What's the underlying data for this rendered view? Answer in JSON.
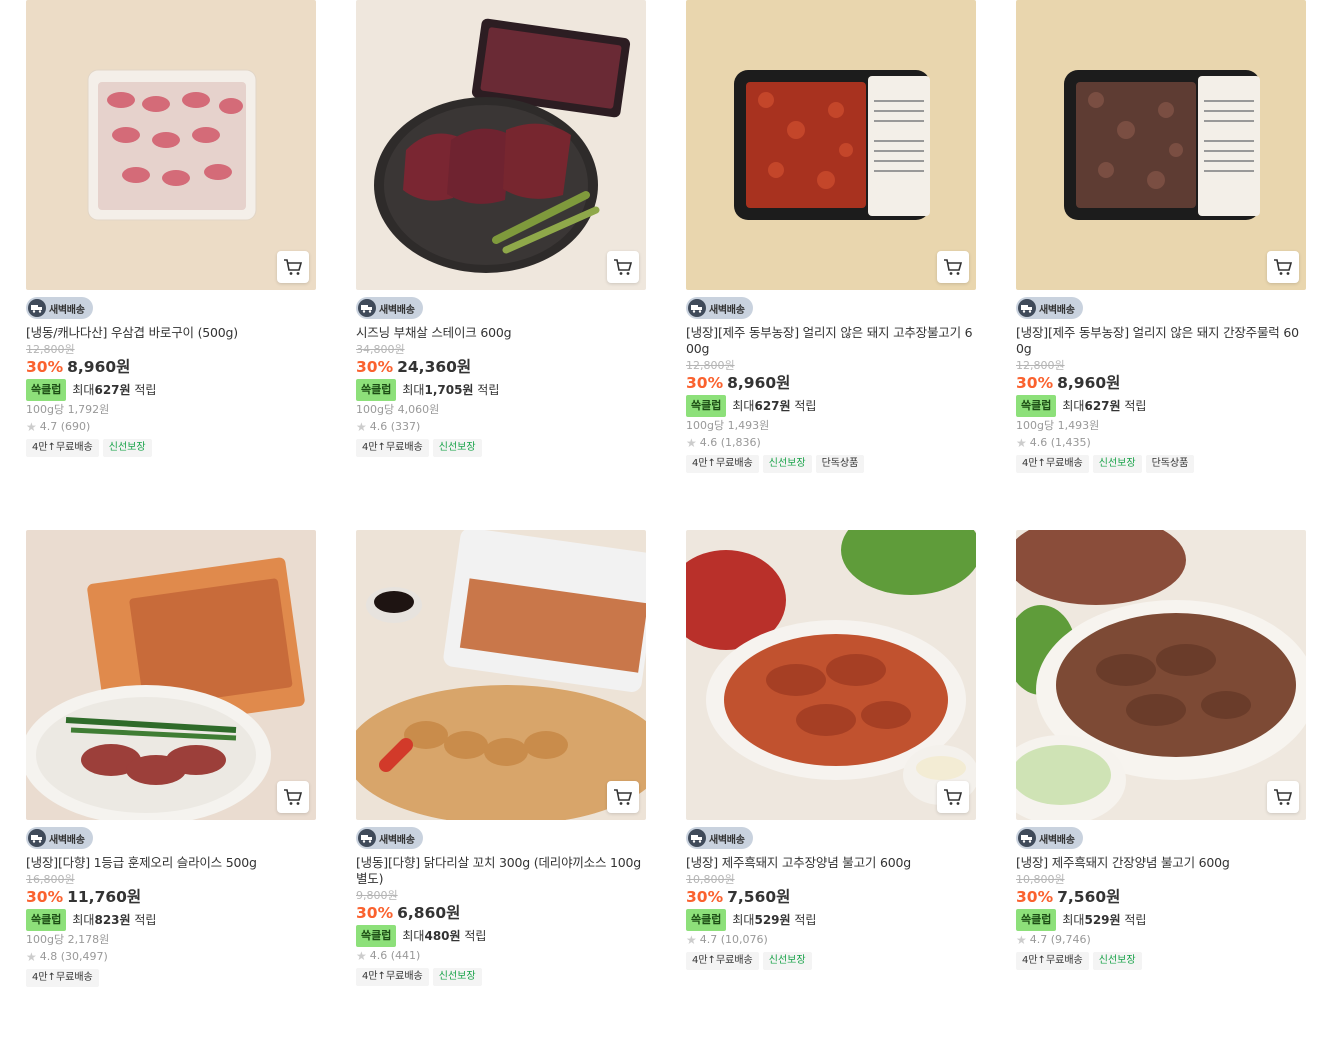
{
  "badge_label": "새벽배송",
  "point_label": "쓱클럽",
  "point_prefix": "최대",
  "point_suffix": "적립",
  "products": [
    {
      "name": "[냉동/캐나다산] 우삼겹 바로구이 (500g)",
      "orig": "12,800원",
      "disc": "30%",
      "price": "8,960원",
      "point": "627원",
      "per100": "100g당 1,792원",
      "rating": "4.7 (690)",
      "tags": [
        "4만↑무료배송",
        "신선보장"
      ]
    },
    {
      "name": "시즈닝 부채살 스테이크 600g",
      "orig": "34,800원",
      "disc": "30%",
      "price": "24,360원",
      "point": "1,705원",
      "per100": "100g당 4,060원",
      "rating": "4.6 (337)",
      "tags": [
        "4만↑무료배송",
        "신선보장"
      ]
    },
    {
      "name": "[냉장][제주 동부농장] 얼리지 않은 돼지 고추장불고기 600g",
      "orig": "12,800원",
      "disc": "30%",
      "price": "8,960원",
      "point": "627원",
      "per100": "100g당 1,493원",
      "rating": "4.6 (1,836)",
      "tags": [
        "4만↑무료배송",
        "신선보장",
        "단독상품"
      ]
    },
    {
      "name": "[냉장][제주 동부농장] 얼리지 않은 돼지 간장주물럭 600g",
      "orig": "12,800원",
      "disc": "30%",
      "price": "8,960원",
      "point": "627원",
      "per100": "100g당 1,493원",
      "rating": "4.6 (1,435)",
      "tags": [
        "4만↑무료배송",
        "신선보장",
        "단독상품"
      ]
    },
    {
      "name": "[냉장][다향] 1등급 훈제오리 슬라이스 500g",
      "orig": "16,800원",
      "disc": "30%",
      "price": "11,760원",
      "point": "823원",
      "per100": "100g당 2,178원",
      "rating": "4.8 (30,497)",
      "tags": [
        "4만↑무료배송"
      ]
    },
    {
      "name": "[냉동][다향] 닭다리살 꼬치 300g (데리야끼소스 100g 별도)",
      "orig": "9,800원",
      "disc": "30%",
      "price": "6,860원",
      "point": "480원",
      "per100": "",
      "rating": "4.6 (441)",
      "tags": [
        "4만↑무료배송",
        "신선보장"
      ]
    },
    {
      "name": "[냉장] 제주흑돼지 고추장양념 불고기 600g",
      "orig": "10,800원",
      "disc": "30%",
      "price": "7,560원",
      "point": "529원",
      "per100": "",
      "rating": "4.7 (10,076)",
      "tags": [
        "4만↑무료배송",
        "신선보장"
      ]
    },
    {
      "name": "[냉장] 제주흑돼지 간장양념 불고기 600g",
      "orig": "10,800원",
      "disc": "30%",
      "price": "7,560원",
      "point": "529원",
      "per100": "",
      "rating": "4.7 (9,746)",
      "tags": [
        "4만↑무료배송",
        "신선보장"
      ]
    }
  ],
  "colors": {
    "discount": "#fa622f",
    "point_tag": "#8de07a",
    "fresh_tag": "#1aa34a"
  },
  "icons": {
    "cart": "cart-icon",
    "badge": "truck-icon",
    "star": "star-icon"
  }
}
